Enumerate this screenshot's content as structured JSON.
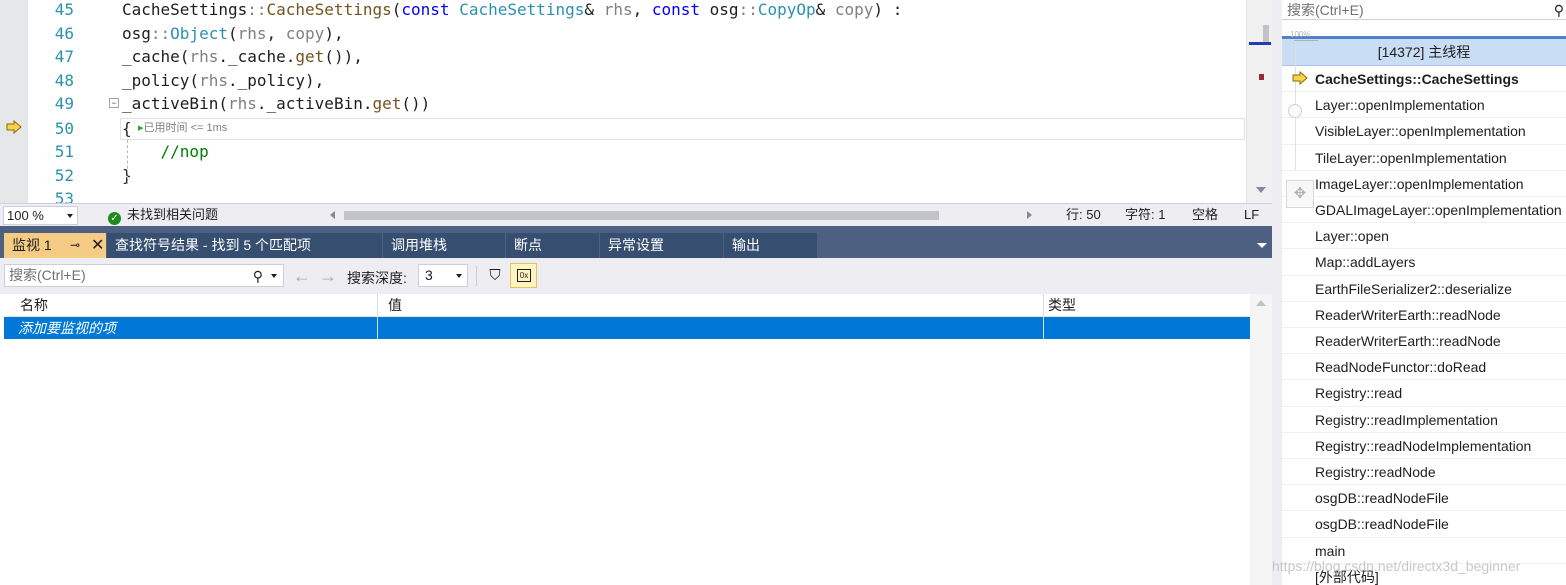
{
  "editor": {
    "lines": [
      {
        "num": "45",
        "tokens": [
          [
            "plain",
            "CacheSettings"
          ],
          [
            "pm",
            "::"
          ],
          [
            "fn",
            "CacheSettings"
          ],
          [
            "plain",
            "("
          ],
          [
            "kw",
            "const"
          ],
          [
            "plain",
            " "
          ],
          [
            "ty",
            "CacheSettings"
          ],
          [
            "plain",
            "& "
          ],
          [
            "pm",
            "rhs"
          ],
          [
            "plain",
            ", "
          ],
          [
            "kw",
            "const"
          ],
          [
            "plain",
            " osg"
          ],
          [
            "pm",
            "::"
          ],
          [
            "ty",
            "CopyOp"
          ],
          [
            "plain",
            "& "
          ],
          [
            "pm",
            "copy"
          ],
          [
            "plain",
            ") :"
          ]
        ]
      },
      {
        "num": "46",
        "tokens": [
          [
            "plain",
            "osg"
          ],
          [
            "pm",
            "::"
          ],
          [
            "ty",
            "Object"
          ],
          [
            "plain",
            "("
          ],
          [
            "pm",
            "rhs"
          ],
          [
            "plain",
            ", "
          ],
          [
            "pm",
            "copy"
          ],
          [
            "plain",
            "),"
          ]
        ]
      },
      {
        "num": "47",
        "tokens": [
          [
            "plain",
            "_cache("
          ],
          [
            "pm",
            "rhs"
          ],
          [
            "plain",
            "._cache."
          ],
          [
            "fn",
            "get"
          ],
          [
            "plain",
            "()),"
          ]
        ]
      },
      {
        "num": "48",
        "tokens": [
          [
            "plain",
            "_policy("
          ],
          [
            "pm",
            "rhs"
          ],
          [
            "plain",
            "._policy),"
          ]
        ]
      },
      {
        "num": "49",
        "tokens": [
          [
            "plain",
            "_activeBin("
          ],
          [
            "pm",
            "rhs"
          ],
          [
            "plain",
            "._activeBin."
          ],
          [
            "fn",
            "get"
          ],
          [
            "plain",
            "())"
          ]
        ]
      },
      {
        "num": "50",
        "tokens": [
          [
            "plain",
            "{"
          ]
        ]
      },
      {
        "num": "51",
        "tokens": [
          [
            "plain",
            "    "
          ],
          [
            "cm",
            "//nop"
          ]
        ]
      },
      {
        "num": "52",
        "tokens": [
          [
            "plain",
            "}"
          ]
        ]
      },
      {
        "num": "53",
        "tokens": [
          [
            "plain",
            ""
          ]
        ]
      }
    ],
    "perf_tip": "已用时间 <= 1ms",
    "collapse_glyph": "−"
  },
  "status": {
    "zoom": "100 %",
    "issues": "未找到相关问题",
    "line": "行: 50",
    "char": "字符: 1",
    "spacing": "空格",
    "eol": "LF"
  },
  "tool_tabs": [
    {
      "label": "监视 1",
      "active": true
    },
    {
      "label": "查找符号结果 - 找到 5 个匹配项",
      "active": false
    },
    {
      "label": "调用堆栈",
      "active": false
    },
    {
      "label": "断点",
      "active": false
    },
    {
      "label": "异常设置",
      "active": false
    },
    {
      "label": "输出",
      "active": false
    }
  ],
  "watch": {
    "search_placeholder": "搜索(Ctrl+E)",
    "depth_label": "搜索深度:",
    "depth_value": "3",
    "columns": {
      "name": "名称",
      "value": "值",
      "type": "类型"
    },
    "add_item_placeholder": "添加要监视的项"
  },
  "call_stack": {
    "search_placeholder": "搜索(Ctrl+E)",
    "thread": "[14372] 主线程",
    "zoom_ghost": "100%",
    "frames": [
      "CacheSettings::CacheSettings",
      "Layer::openImplementation",
      "VisibleLayer::openImplementation",
      "TileLayer::openImplementation",
      "ImageLayer::openImplementation",
      "GDALImageLayer::openImplementation",
      "Layer::open",
      "Map::addLayers",
      "EarthFileSerializer2::deserialize",
      "ReaderWriterEarth::readNode",
      "ReaderWriterEarth::readNode",
      "ReadNodeFunctor::doRead",
      "Registry::read",
      "Registry::readImplementation",
      "Registry::readNodeImplementation",
      "Registry::readNode",
      "osgDB::readNodeFile",
      "osgDB::readNodeFile",
      "main",
      "[外部代码]"
    ]
  },
  "watermark": "https://blog.csdn.net/directx3d_beginner",
  "colors": {
    "tab_bar": "#4d6082",
    "active_tab": "#f5cc84",
    "selection": "#0078d7",
    "thread_row": "#c9def5"
  }
}
